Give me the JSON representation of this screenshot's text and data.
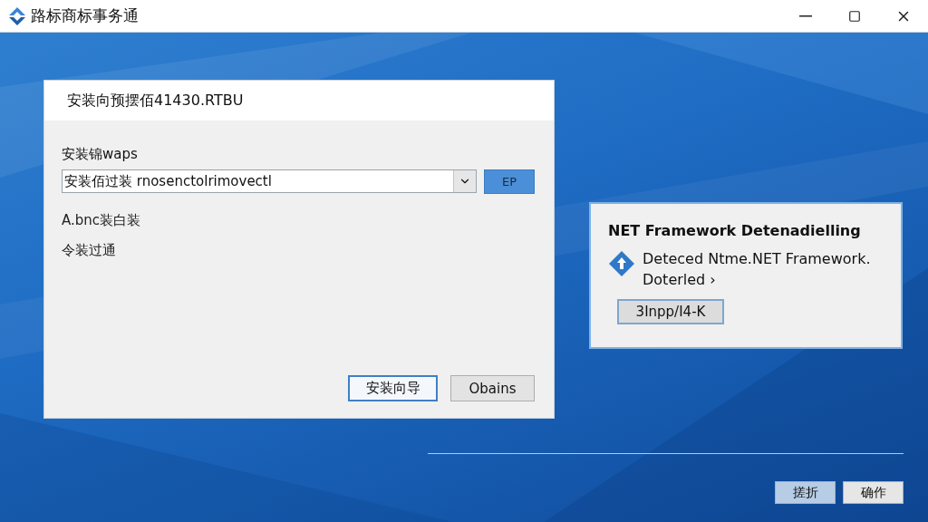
{
  "window": {
    "title": "路标商标事务通"
  },
  "dialog": {
    "heading": "安装向预摆佰41430.RTBU",
    "field_label": "安装锦waps",
    "combo": {
      "value": "安装佰过装 rnosenctolrimovectl"
    },
    "combo_button": "EP",
    "lines": [
      "A.bnc装白装",
      "令装过通"
    ],
    "buttons": [
      {
        "label": "安装向导",
        "selected": true
      },
      {
        "label": "Obains",
        "selected": false
      }
    ]
  },
  "notification": {
    "title": "NET Framework Detenadielling",
    "message": "Deteced Ntme.NET Framework.",
    "detail": "Doterled ›",
    "button": "3Inpp/I4-K"
  },
  "footer_buttons": [
    {
      "label": "搓折",
      "selected": true
    },
    {
      "label": "确作",
      "selected": false
    }
  ]
}
